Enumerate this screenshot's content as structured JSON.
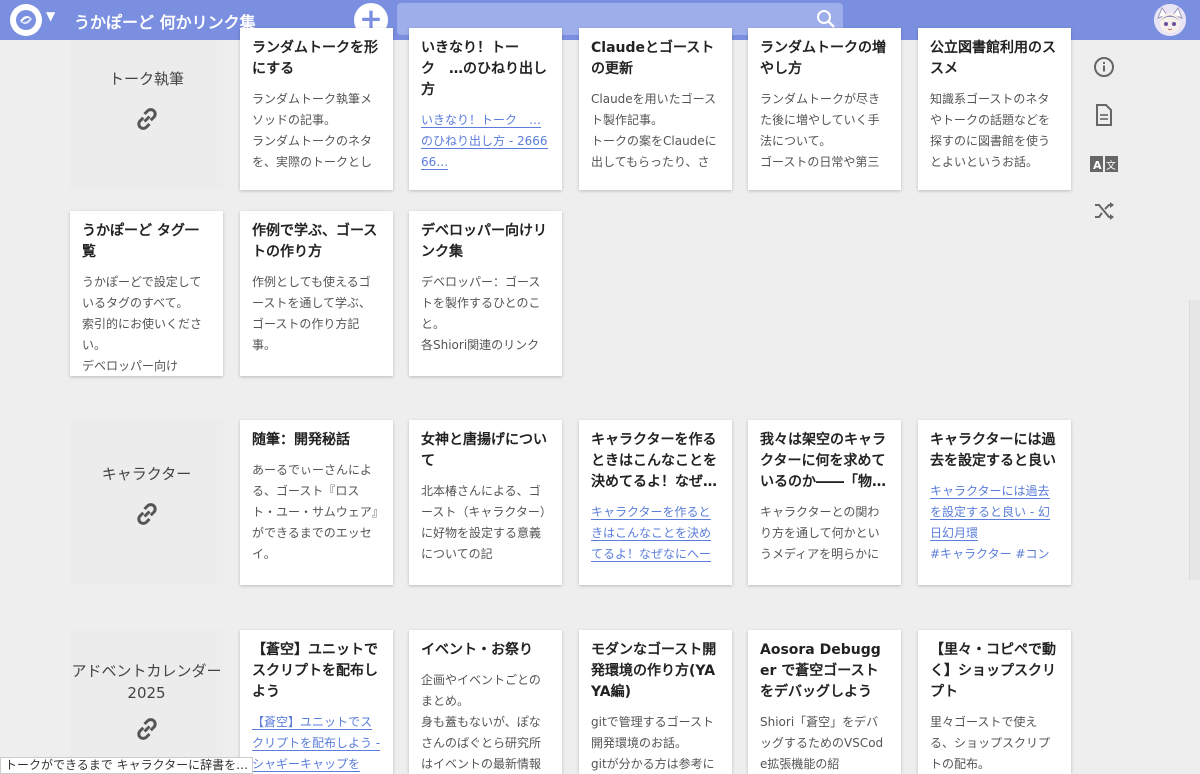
{
  "header": {
    "title": "うかぽーど 何かリンク集",
    "search_value": ""
  },
  "toolbar": {
    "icons": [
      "info-icon",
      "document-icon",
      "translate-icon",
      "shuffle-icon"
    ]
  },
  "sections": [
    {
      "label": "トーク執筆",
      "cards": [
        {
          "title": "ランダムトークを形にする",
          "desc": "ランダムトーク執筆メソッドの記事。\nランダムトークのネタを、実際のトークとし"
        },
        {
          "title": "いきなり！トーク　…のひねり出し方",
          "link": "いきなり！トーク　…のひねり出し方 - 266666…"
        },
        {
          "title": "Claudeとゴーストの更新",
          "desc": "Claudeを用いたゴースト製作記事。\nトークの案をClaudeに出してもらったり、さ"
        },
        {
          "title": "ランダムトークの増やし方",
          "desc": "ランダムトークが尽きた後に増やしていく手法について。\nゴーストの日常や第三"
        },
        {
          "title": "公立図書館利用のススメ",
          "desc": "知識系ゴーストのネタやトークの話題などを探すのに図書館を使うとよいというお話。"
        },
        {
          "title": "うかぽーど タグ一覧",
          "desc": "うかぽーどで設定しているタグのすべて。\n索引的にお使いください。\nデベロッパー向け"
        },
        {
          "title": "作例で学ぶ、ゴーストの作り方",
          "desc": "作例としても使えるゴーストを通して学ぶ、ゴーストの作り方記事。"
        },
        {
          "title": "デベロッパー向けリンク集",
          "desc": "デベロッパー：ゴーストを製作するひとのこと。\n各Shiori関連のリンク"
        }
      ]
    },
    {
      "label": "キャラクター",
      "cards": [
        {
          "title": "随筆：開発秘話",
          "desc": "あーるでぃーさんによる、ゴースト『ロスト・ユー・サムウェア』ができるまでのエッセイ。"
        },
        {
          "title": "女神と唐揚げについて",
          "desc": "北本椿さんによる、ゴースト（キャラクター）に好物を設定する意義についての記"
        },
        {
          "title": "キャラクターを作るときはこんなことを決めてるよ！なぜ…",
          "link": "キャラクターを作るときはこんなことを決めてるよ！なぜなにへー"
        },
        {
          "title": "我々は架空のキャラクターに何を求めているのか――「物…",
          "desc": "キャラクターとの関わり方を通して何かというメディアを明らかに"
        },
        {
          "title": "キャラクターには過去を設定すると良い",
          "link": "キャラクターには過去を設定すると良い - 幻日幻月環",
          "desc": "#キャラクター #コン"
        }
      ]
    },
    {
      "label": "アドベントカレンダー2025",
      "cards": [
        {
          "title": "【蒼空】ユニットでスクリプトを配布しよう",
          "link": "【蒼空】ユニットでスクリプトを配布しよう - シャギーキャップを"
        },
        {
          "title": "イベント・お祭り",
          "desc": "企画やイベントごとのまとめ。\n身も蓋もないが、ぽなさんのぱぐとら研究所はイベントの最新情報"
        },
        {
          "title": "モダンなゴースト開発環境の作り方(YAYA編)",
          "desc": "gitで管理するゴースト開発環境のお話。\ngitが分かる方は参考に"
        },
        {
          "title": "Aosora Debugger で蒼空ゴーストをデバッグしよう",
          "desc": "Shiori「蒼空」をデバッグするためのVSCode拡張機能の紹"
        },
        {
          "title": "【里々・コピペで動く】ショップスクリプト",
          "desc": "里々ゴーストで使える、ショップスクリプトの配布。"
        }
      ]
    }
  ],
  "status_bar": {
    "text": "トークができるまで キャラクターに辞書を…"
  }
}
